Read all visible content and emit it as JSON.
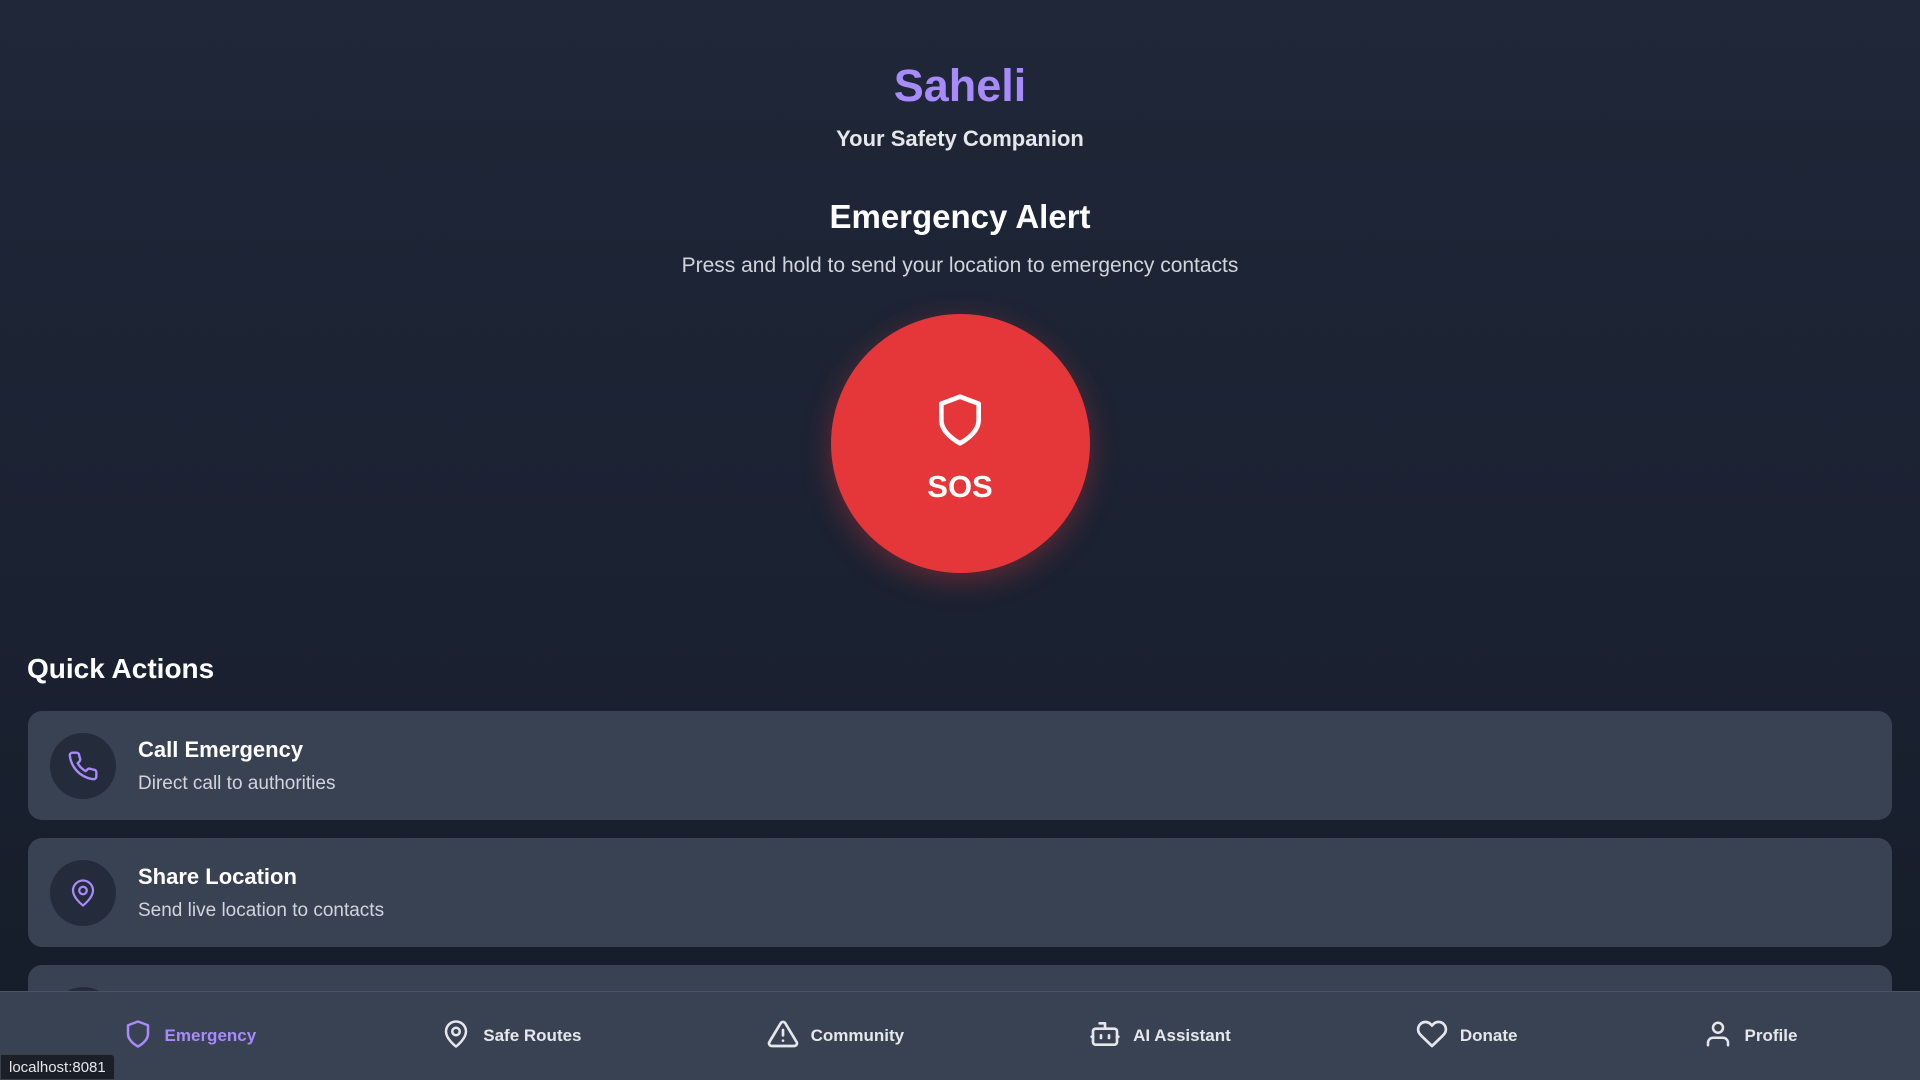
{
  "header": {
    "title": "Saheli",
    "subtitle": "Your Safety Companion"
  },
  "emergency": {
    "title": "Emergency Alert",
    "description": "Press and hold to send your location to emergency contacts",
    "sos_label": "SOS"
  },
  "quick_actions": {
    "title": "Quick Actions",
    "items": [
      {
        "title": "Call Emergency",
        "description": "Direct call to authorities",
        "icon": "phone-icon"
      },
      {
        "title": "Share Location",
        "description": "Send live location to contacts",
        "icon": "map-pin-icon"
      }
    ]
  },
  "nav": {
    "items": [
      {
        "label": "Emergency",
        "icon": "shield-icon",
        "active": true
      },
      {
        "label": "Safe Routes",
        "icon": "map-pin-icon"
      },
      {
        "label": "Community",
        "icon": "warning-triangle-icon"
      },
      {
        "label": "AI Assistant",
        "icon": "bot-icon"
      },
      {
        "label": "Donate",
        "icon": "heart-icon"
      },
      {
        "label": "Profile",
        "icon": "user-icon"
      }
    ]
  },
  "status_bar": {
    "url": "localhost:8081"
  },
  "colors": {
    "accent": "#a78bfa",
    "sos": "#e5363a",
    "card": "#394253",
    "background": "#1b2232"
  }
}
